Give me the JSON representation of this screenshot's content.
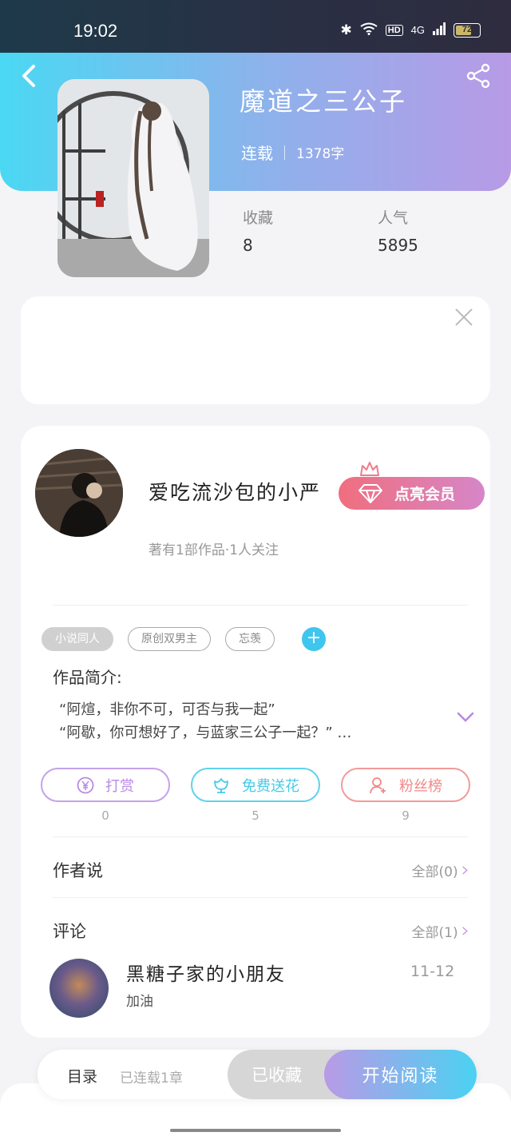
{
  "status_bar": {
    "time": "19:02",
    "network": "4G",
    "hd": "HD",
    "battery": "72",
    "battery_level": 0.72
  },
  "header": {
    "back_icon": "chevron-left-icon",
    "share_icon": "share-icon"
  },
  "book": {
    "title": "魔道之三公子",
    "status": "连载",
    "word_count": "1378字",
    "stats": [
      {
        "label": "收藏",
        "value": "8"
      },
      {
        "label": "人气",
        "value": "5895"
      }
    ]
  },
  "ad": {
    "close_icon": "close-icon"
  },
  "author": {
    "name": "爱吃流沙包的小严",
    "subtitle": "著有1部作品·1人关注",
    "vip_button": "点亮会员"
  },
  "tags": [
    "小说同人",
    "原创双男主",
    "忘羡"
  ],
  "intro": {
    "label": "作品简介:",
    "lines": [
      "“阿煊，非你不可，可否与我一起”",
      "“阿歇，你可想好了，与蓝家三公子一起？” …"
    ]
  },
  "actions": [
    {
      "label": "打赏",
      "count": "0",
      "icon": "yen-coin-icon",
      "color": "#b88ae6"
    },
    {
      "label": "免费送花",
      "count": "5",
      "icon": "flower-icon",
      "color": "#44cbe8"
    },
    {
      "label": "粉丝榜",
      "count": "9",
      "icon": "fan-person-icon",
      "color": "#f08888"
    }
  ],
  "author_says": {
    "title": "作者说",
    "more": "全部(0)"
  },
  "comments": {
    "title": "评论",
    "more": "全部(1)",
    "items": [
      {
        "user": "黑糖子家的小朋友",
        "text": "加油",
        "date": "11-12"
      }
    ]
  },
  "bottom_bar": {
    "catalog": "目录",
    "updated": "已连载1章",
    "collected": "已收藏",
    "start_reading": "开始阅读"
  }
}
